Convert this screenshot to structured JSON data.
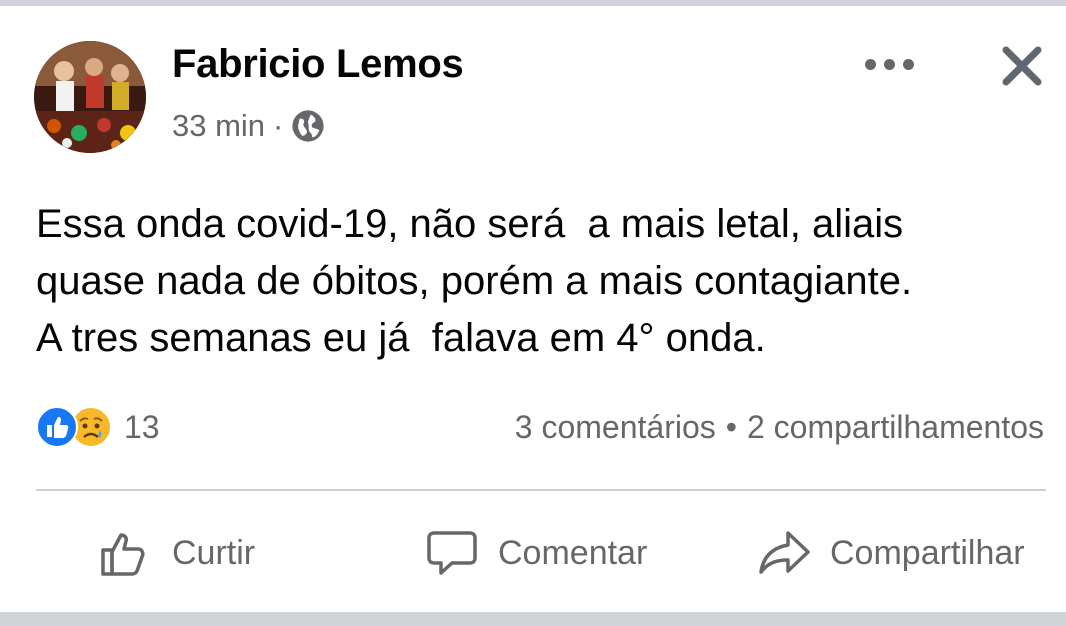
{
  "post": {
    "author": "Fabricio Lemos",
    "time": "33 min",
    "separator": "·",
    "privacy_icon": "globe-icon",
    "text": "Essa onda covid-19, não será  a mais letal, aliais\nquase nada de óbitos, porém a mais contagiante.\nA tres semanas eu já  falava em 4° onda."
  },
  "header": {
    "more_icon": "more-icon",
    "close_icon": "close-icon"
  },
  "reactions": {
    "icons": [
      "like-reaction-icon",
      "sad-reaction-icon"
    ],
    "count": "13"
  },
  "stats": {
    "comments": "3 comentários",
    "separator": "•",
    "shares": "2 compartilhamentos"
  },
  "actions": {
    "like": "Curtir",
    "comment": "Comentar",
    "share": "Compartilhar"
  },
  "colors": {
    "text": "#050505",
    "secondary": "#65676b",
    "like_blue": "#1877f2",
    "divider": "#ced0d4"
  }
}
